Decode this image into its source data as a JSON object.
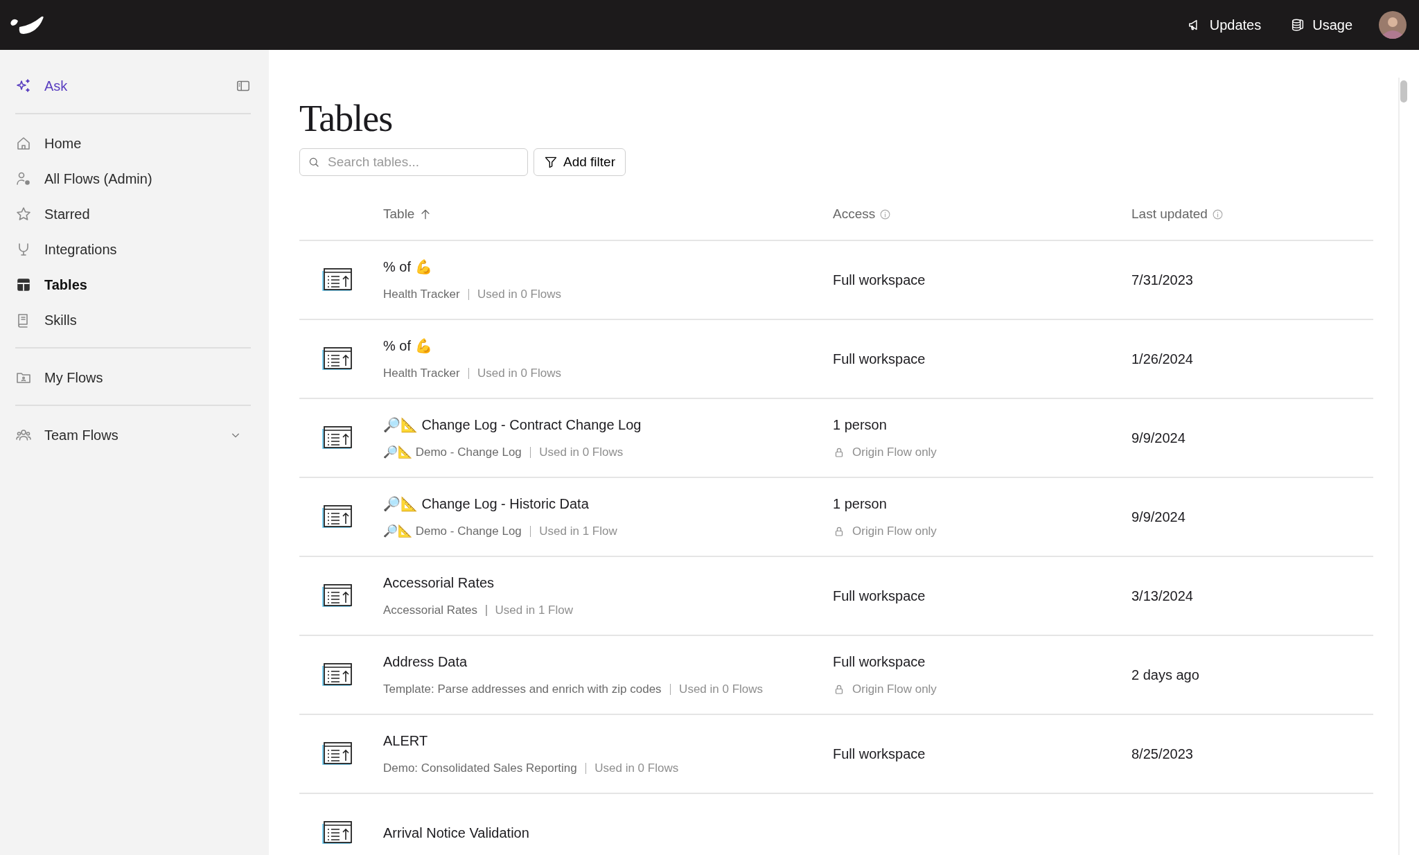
{
  "topbar": {
    "links": [
      {
        "label": "Updates"
      },
      {
        "label": "Usage"
      }
    ]
  },
  "sidebar": {
    "ask": {
      "label": "Ask"
    },
    "groups": [
      [
        {
          "label": "Home",
          "selected": false
        },
        {
          "label": "All Flows (Admin)",
          "selected": false
        },
        {
          "label": "Starred",
          "selected": false
        },
        {
          "label": "Integrations",
          "selected": false
        },
        {
          "label": "Tables",
          "selected": true
        },
        {
          "label": "Skills",
          "selected": false
        }
      ],
      [
        {
          "label": "My Flows",
          "selected": false
        }
      ],
      [
        {
          "label": "Team Flows",
          "selected": false,
          "expanded": false
        }
      ]
    ]
  },
  "page": {
    "title": "Tables",
    "search": {
      "placeholder": "Search tables..."
    },
    "filter_button": "Add filter"
  },
  "table": {
    "columns": [
      {
        "label": "Table",
        "sorted": true,
        "info": false
      },
      {
        "label": "Access",
        "info": true
      },
      {
        "label": "Last updated",
        "info": true
      }
    ],
    "rows": [
      {
        "name": "% of 💪",
        "source": "Health Tracker",
        "usage": "Used in 0 Flows",
        "access": "Full workspace",
        "updated": "7/31/2023"
      },
      {
        "name": "% of 💪",
        "source": "Health Tracker",
        "usage": "Used in 0 Flows",
        "access": "Full workspace",
        "updated": "1/26/2024"
      },
      {
        "name": "🔎📐 Change Log - Contract Change Log",
        "source": "🔎📐 Demo - Change Log",
        "usage": "Used in 0 Flows",
        "access": "1 person",
        "restriction": "Origin Flow only",
        "updated": "9/9/2024"
      },
      {
        "name": "🔎📐 Change Log - Historic Data",
        "source": "🔎📐 Demo - Change Log",
        "usage": "Used in 1 Flow",
        "access": "1 person",
        "restriction": "Origin Flow only",
        "updated": "9/9/2024"
      },
      {
        "name": "Accessorial Rates",
        "source": "Accessorial Rates",
        "usage": "Used in 1 Flow",
        "access": "Full workspace",
        "updated": "3/13/2024"
      },
      {
        "name": "Address Data",
        "source": "Template: Parse addresses and enrich with zip codes",
        "usage": "Used in 0 Flows",
        "access": "Full workspace",
        "restriction": "Origin Flow only",
        "updated": "2 days ago"
      },
      {
        "name": "ALERT",
        "source": "Demo: Consolidated Sales Reporting",
        "usage": "Used in 0 Flows",
        "access": "Full workspace",
        "updated": "8/25/2023"
      },
      {
        "name": "Arrival Notice Validation"
      }
    ]
  }
}
